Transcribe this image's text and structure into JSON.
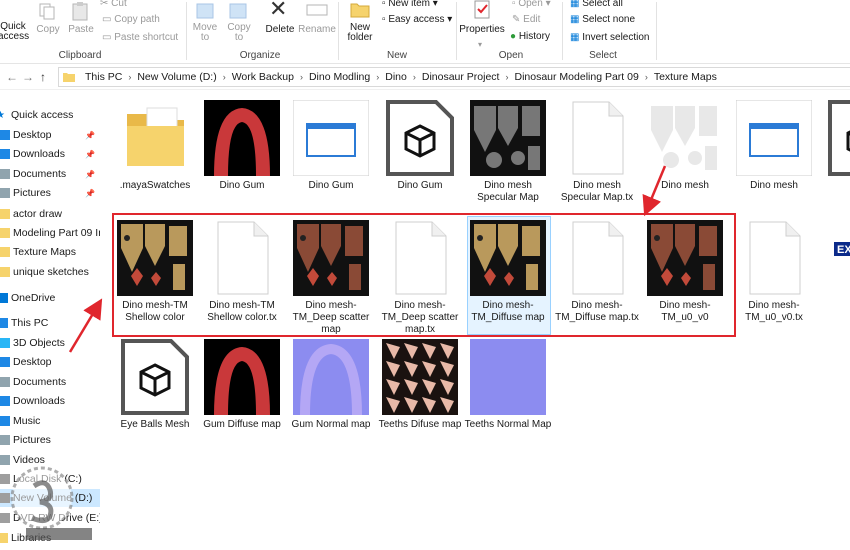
{
  "ribbon": {
    "clipboard": {
      "quick_access_label": "Quick\naccess",
      "copy_label": "Copy",
      "paste_label": "Paste",
      "cut_label": "Cut",
      "copy_path_label": "Copy path",
      "paste_shortcut_label": "Paste shortcut",
      "group_label": "Clipboard"
    },
    "organize": {
      "move_to_label": "Move\nto",
      "copy_to_label": "Copy\nto",
      "delete_label": "Delete",
      "rename_label": "Rename",
      "group_label": "Organize"
    },
    "new": {
      "new_folder_label": "New\nfolder",
      "new_item_label": "New item",
      "easy_access_label": "Easy access",
      "group_label": "New"
    },
    "open": {
      "properties_label": "Properties",
      "open_label": "Open",
      "edit_label": "Edit",
      "history_label": "History",
      "group_label": "Open"
    },
    "select": {
      "select_all_label": "Select all",
      "select_none_label": "Select none",
      "invert_selection_label": "Invert selection",
      "group_label": "Select"
    }
  },
  "address": {
    "crumbs": [
      "This PC",
      "New Volume (D:)",
      "Work Backup",
      "Dino Modling",
      "Dino",
      "Dinosaur Project",
      "Dinosaur Modeling Part 09",
      "Texture Maps"
    ]
  },
  "nav": {
    "items": [
      {
        "label": "Quick access",
        "icon": "star-icon"
      },
      {
        "label": "Desktop",
        "icon": "desktop-icon",
        "pinned": true
      },
      {
        "label": "Downloads",
        "icon": "downloads-icon",
        "pinned": true
      },
      {
        "label": "Documents",
        "icon": "documents-icon",
        "pinned": true
      },
      {
        "label": "Pictures",
        "icon": "pictures-icon",
        "pinned": true
      },
      {
        "label": "actor draw",
        "icon": "folder-icon"
      },
      {
        "label": "Modeling Part 09 In",
        "icon": "folder-icon"
      },
      {
        "label": "Texture Maps",
        "icon": "folder-icon"
      },
      {
        "label": "unique sketches",
        "icon": "folder-icon"
      },
      {
        "label": "OneDrive",
        "icon": "cloud-icon"
      },
      {
        "label": "This PC",
        "icon": "computer-icon"
      },
      {
        "label": "3D Objects",
        "icon": "cube-icon"
      },
      {
        "label": "Desktop",
        "icon": "desktop-icon"
      },
      {
        "label": "Documents",
        "icon": "documents-icon"
      },
      {
        "label": "Downloads",
        "icon": "downloads-icon"
      },
      {
        "label": "Music",
        "icon": "music-icon"
      },
      {
        "label": "Pictures",
        "icon": "pictures-icon"
      },
      {
        "label": "Videos",
        "icon": "videos-icon"
      },
      {
        "label": "Local Disk (C:)",
        "icon": "drive-icon"
      },
      {
        "label": "New Volume (D:)",
        "icon": "drive-icon",
        "selected": true
      },
      {
        "label": "DVD RW Drive (E:) T",
        "icon": "dvd-icon"
      },
      {
        "label": "Libraries",
        "icon": "libraries-icon"
      }
    ]
  },
  "files": {
    "row1": [
      {
        "name": ".mayaSwatches",
        "kind": "folder"
      },
      {
        "name": "Dino Gum",
        "kind": "red-texture"
      },
      {
        "name": "Dino Gum",
        "kind": "window"
      },
      {
        "name": "Dino Gum",
        "kind": "obj"
      },
      {
        "name": "Dino mesh Specular Map",
        "kind": "specular"
      },
      {
        "name": "Dino mesh Specular Map.tx",
        "kind": "blank"
      },
      {
        "name": "Dino mesh",
        "kind": "mesh-white"
      },
      {
        "name": "Dino mesh",
        "kind": "window"
      },
      {
        "name": "Di",
        "kind": "obj"
      }
    ],
    "row2": [
      {
        "name": "Dino mesh-TM Shellow color",
        "kind": "diffuse"
      },
      {
        "name": "Dino mesh-TM Shellow color.tx",
        "kind": "blank"
      },
      {
        "name": "Dino mesh-TM_Deep scatter map",
        "kind": "deep"
      },
      {
        "name": "Dino mesh-TM_Deep scatter map.tx",
        "kind": "blank"
      },
      {
        "name": "Dino mesh-TM_Diffuse map",
        "kind": "diffuse"
      },
      {
        "name": "Dino mesh-TM_Diffuse map.tx",
        "kind": "blank"
      },
      {
        "name": "Dino mesh-TM_u0_v0",
        "kind": "deep"
      },
      {
        "name": "Dino mesh-TM_u0_v0.tx",
        "kind": "blank"
      },
      {
        "name": "",
        "kind": "exr"
      }
    ],
    "row3": [
      {
        "name": "Eye Balls Mesh",
        "kind": "obj"
      },
      {
        "name": "Gum Diffuse map",
        "kind": "red-texture"
      },
      {
        "name": "Gum Normal map",
        "kind": "normal-gum"
      },
      {
        "name": "Teeths Difuse map",
        "kind": "teeth"
      },
      {
        "name": "Teeths Normal Map",
        "kind": "normal"
      }
    ],
    "exr_badge": "EX"
  },
  "colors": {
    "accent": "#0078d7",
    "selection": "#cce8ff",
    "highlight_border": "#e0262d",
    "folder": "#f6d36c"
  }
}
